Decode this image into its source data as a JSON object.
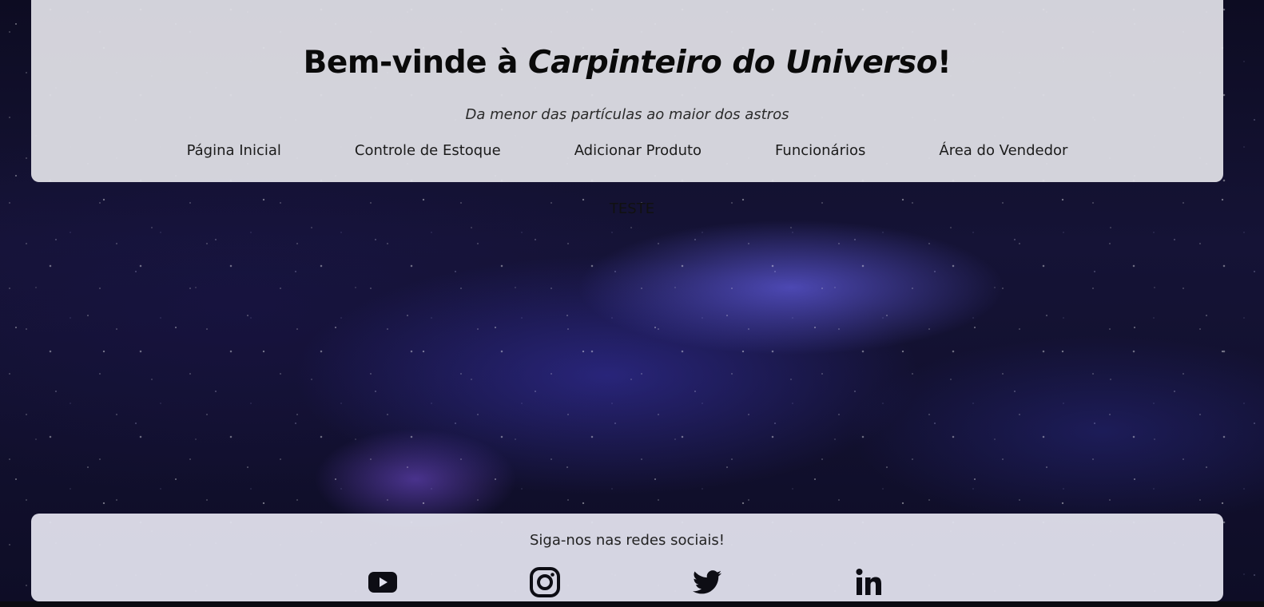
{
  "header": {
    "title_prefix": "Bem-vinde à ",
    "title_brand": "Carpinteiro do Universo",
    "title_suffix": "!",
    "subtitle": "Da menor das partículas ao maior dos astros"
  },
  "nav": {
    "items": [
      {
        "label": "Página Inicial"
      },
      {
        "label": "Controle de Estoque"
      },
      {
        "label": "Adicionar Produto"
      },
      {
        "label": "Funcionários"
      },
      {
        "label": "Área do Vendedor"
      }
    ]
  },
  "main": {
    "text": "TESTE"
  },
  "footer": {
    "follow_text": "Siga-nos nas redes sociais!",
    "socials": [
      {
        "icon": "youtube-icon"
      },
      {
        "icon": "instagram-icon"
      },
      {
        "icon": "twitter-icon"
      },
      {
        "icon": "linkedin-icon"
      }
    ]
  },
  "colors": {
    "panel": "#e2e2e8",
    "text": "#0a0a0a",
    "background": "#151336"
  }
}
